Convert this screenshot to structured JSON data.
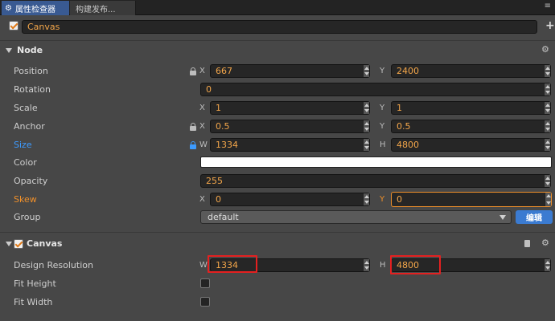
{
  "tabs": {
    "active_label": "属性检查器",
    "inactive_label": "构建发布...",
    "menu_glyph": "≡"
  },
  "header": {
    "node_name": "Canvas",
    "add_glyph": "+"
  },
  "node_section": {
    "title": "Node",
    "position": {
      "label": "Position",
      "x_axis": "X",
      "x": "667",
      "y_axis": "Y",
      "y": "2400"
    },
    "rotation": {
      "label": "Rotation",
      "value": "0"
    },
    "scale": {
      "label": "Scale",
      "x_axis": "X",
      "x": "1",
      "y_axis": "Y",
      "y": "1"
    },
    "anchor": {
      "label": "Anchor",
      "x_axis": "X",
      "x": "0.5",
      "y_axis": "Y",
      "y": "0.5"
    },
    "size": {
      "label": "Size",
      "w_axis": "W",
      "w": "1334",
      "h_axis": "H",
      "h": "4800"
    },
    "color": {
      "label": "Color",
      "value": "#ffffff"
    },
    "opacity": {
      "label": "Opacity",
      "value": "255"
    },
    "skew": {
      "label": "Skew",
      "x_axis": "X",
      "x": "0",
      "y_axis": "Y",
      "y": "0"
    },
    "group": {
      "label": "Group",
      "value": "default",
      "edit_label": "编辑"
    }
  },
  "canvas_section": {
    "title": "Canvas",
    "design_resolution": {
      "label": "Design Resolution",
      "w_axis": "W",
      "w": "1334",
      "h_axis": "H",
      "h": "4800"
    },
    "fit_height": {
      "label": "Fit Height",
      "checked": false
    },
    "fit_width": {
      "label": "Fit Width",
      "checked": false
    }
  },
  "colors": {
    "accent_blue": "#3d9bff",
    "accent_orange": "#f0902a",
    "highlight_red": "#e52020",
    "edit_button": "#3b7bd1"
  }
}
